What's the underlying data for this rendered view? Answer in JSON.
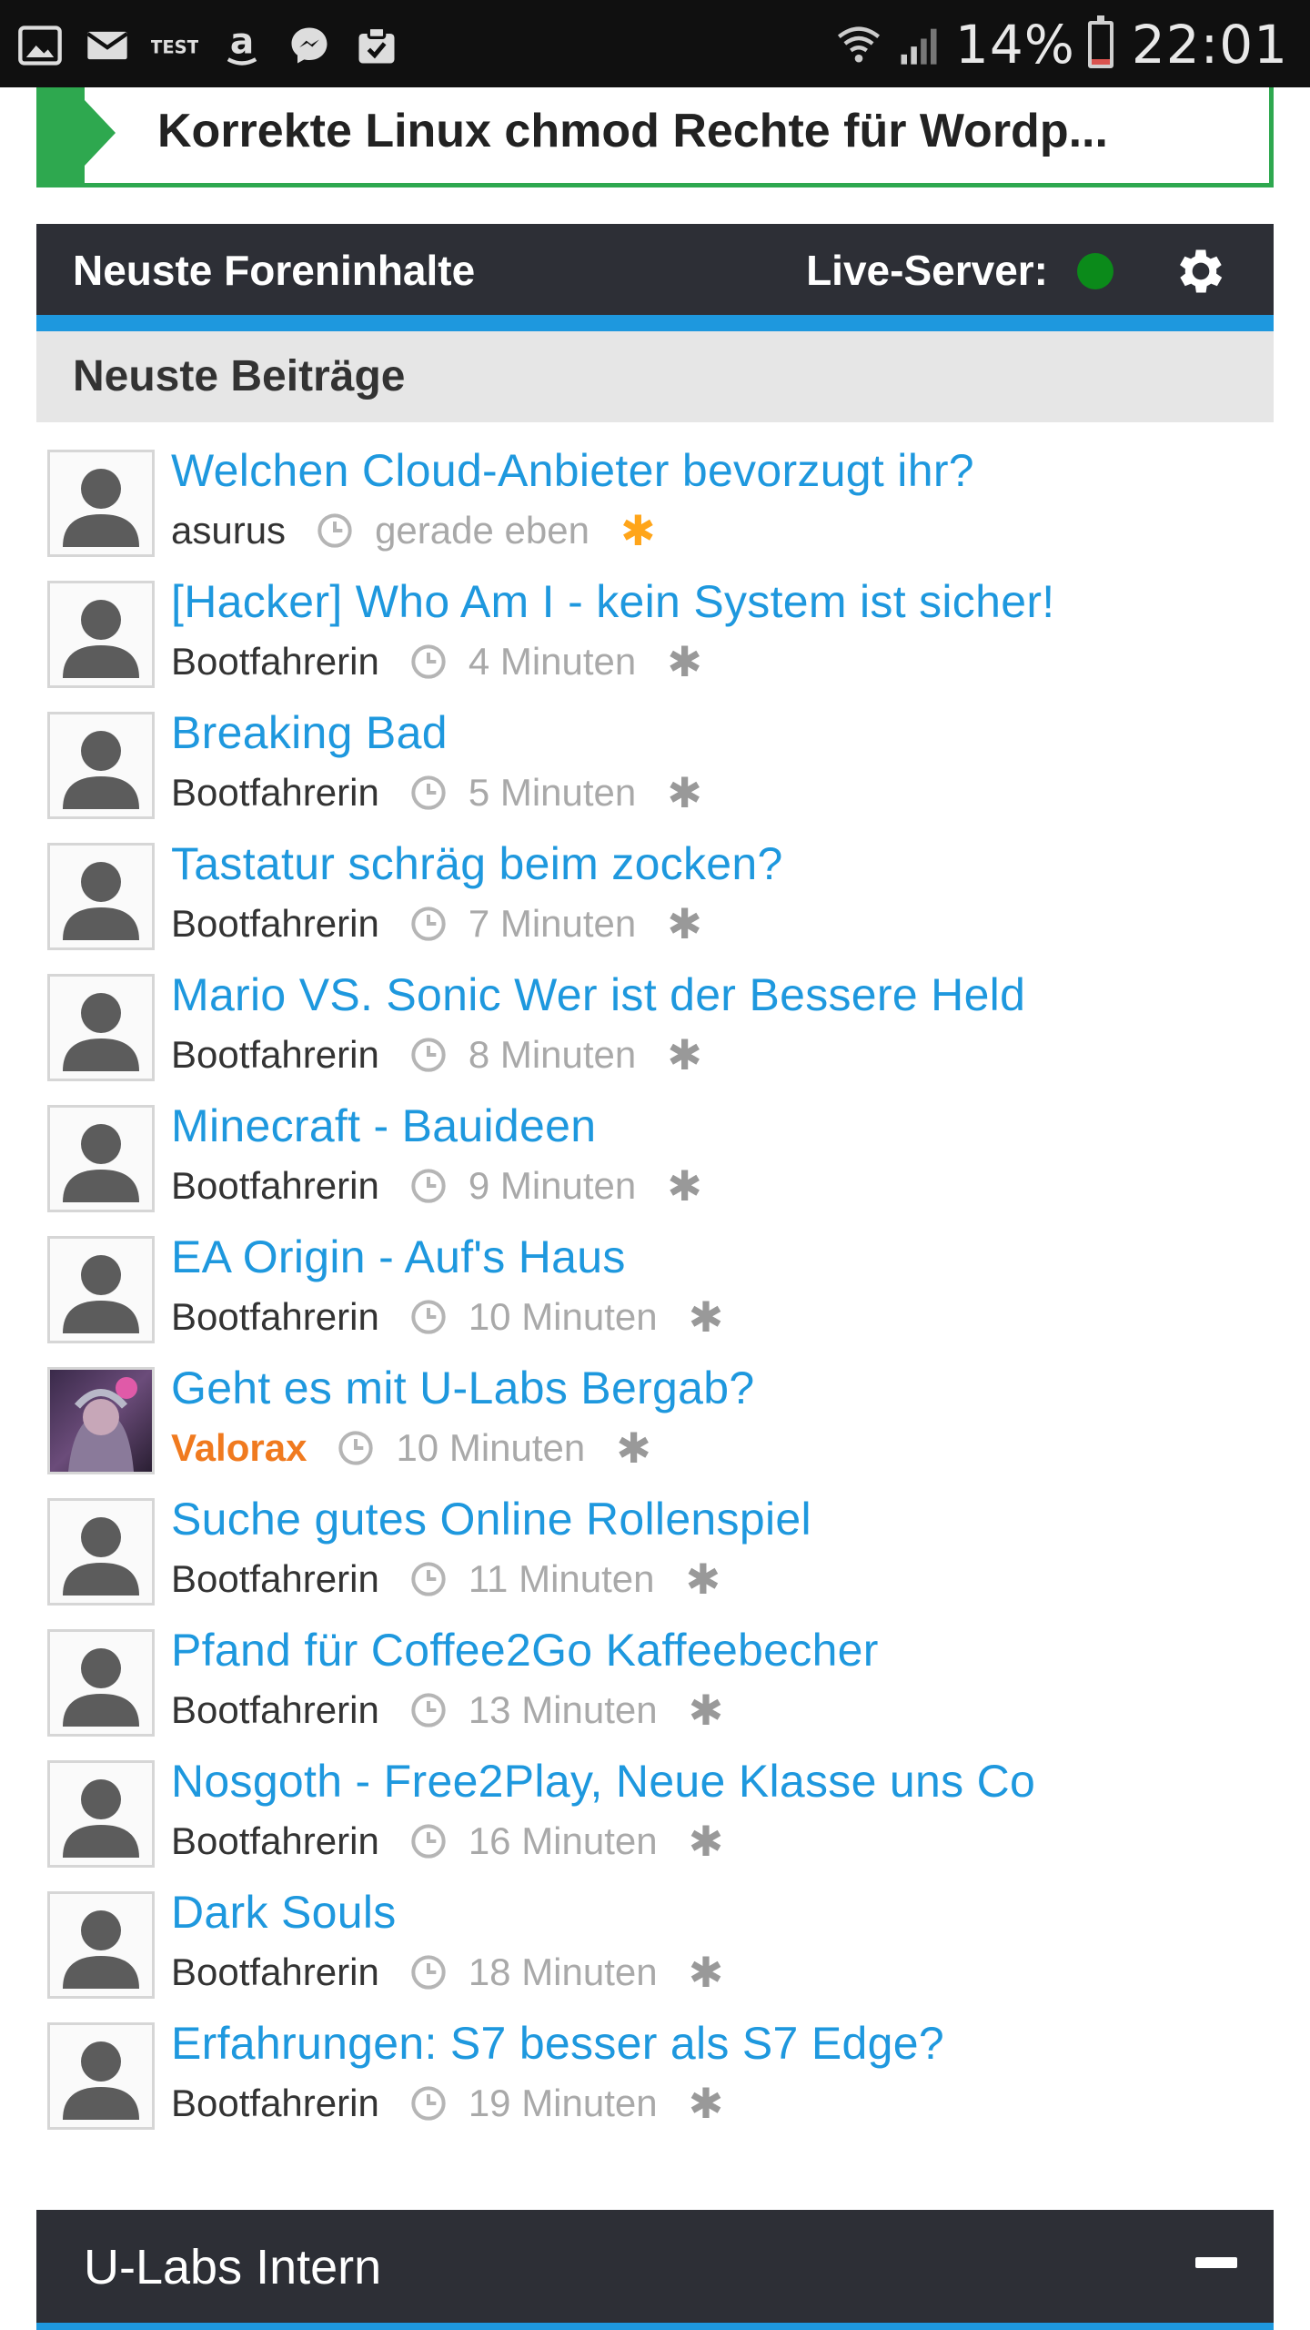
{
  "status_bar": {
    "battery": "14%",
    "time": "22:01",
    "battery_level": 0.14,
    "left_icons": [
      "gallery-icon",
      "mail-icon",
      "test-icon",
      "amazon-icon",
      "messenger-icon",
      "clipboard-check-icon"
    ],
    "right_icons": [
      "wifi-icon",
      "signal-icon",
      "battery-icon"
    ]
  },
  "breadcrumb": {
    "title": "Korrekte Linux chmod Rechte für Wordp...",
    "accent_color": "#2ea84f"
  },
  "forum_panel": {
    "title": "Neuste Foreninhalte",
    "live_label": "Live-Server:",
    "live_status_color": "#0b8a1a",
    "accent_color": "#1e98de",
    "section_title": "Neuste Beiträge"
  },
  "posts": [
    {
      "title": "Welchen Cloud-Anbieter bevorzugt ihr?",
      "author": "asurus",
      "time": "gerade eben",
      "is_new": true
    },
    {
      "title": "[Hacker] Who Am I - kein System ist sicher!",
      "author": "Bootfahrerin",
      "time": "4 Minuten",
      "is_new": false
    },
    {
      "title": "Breaking Bad",
      "author": "Bootfahrerin",
      "time": "5 Minuten",
      "is_new": false
    },
    {
      "title": "Tastatur schräg beim zocken?",
      "author": "Bootfahrerin",
      "time": "7 Minuten",
      "is_new": false
    },
    {
      "title": "Mario VS. Sonic Wer ist der Bessere Held",
      "author": "Bootfahrerin",
      "time": "8 Minuten",
      "is_new": false
    },
    {
      "title": "Minecraft - Bauideen",
      "author": "Bootfahrerin",
      "time": "9 Minuten",
      "is_new": false
    },
    {
      "title": "EA Origin - Auf's Haus",
      "author": "Bootfahrerin",
      "time": "10 Minuten",
      "is_new": false
    },
    {
      "title": "Geht es mit U-Labs Bergab?",
      "author": "Valorax",
      "time": "10 Minuten",
      "is_new": false,
      "author_special": true,
      "avatar": "custom"
    },
    {
      "title": "Suche gutes Online Rollenspiel",
      "author": "Bootfahrerin",
      "time": "11 Minuten",
      "is_new": false
    },
    {
      "title": "Pfand für Coffee2Go Kaffeebecher",
      "author": "Bootfahrerin",
      "time": "13 Minuten",
      "is_new": false
    },
    {
      "title": "Nosgoth - Free2Play, Neue Klasse uns Co",
      "author": "Bootfahrerin",
      "time": "16 Minuten",
      "is_new": false
    },
    {
      "title": "Dark Souls",
      "author": "Bootfahrerin",
      "time": "18 Minuten",
      "is_new": false
    },
    {
      "title": "Erfahrungen: S7 besser als S7 Edge?",
      "author": "Bootfahrerin",
      "time": "19 Minuten",
      "is_new": false
    }
  ],
  "bottom_panel": {
    "title": "U-Labs Intern"
  }
}
